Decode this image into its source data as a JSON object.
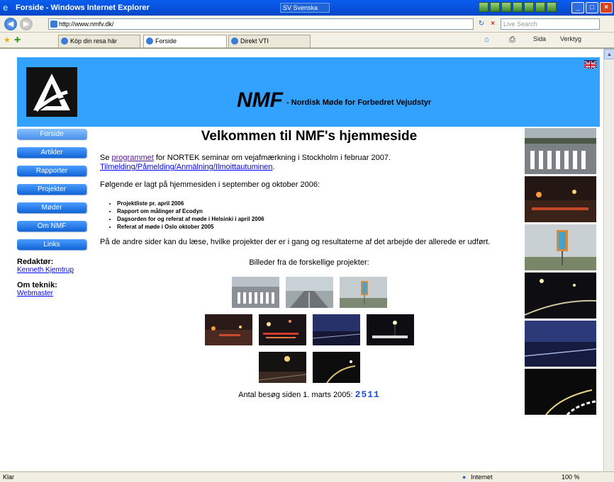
{
  "browser": {
    "title": "Forside - Windows Internet Explorer",
    "language": "SV Svenska",
    "address": "http://www.nmfv.dk/",
    "search_placeholder": "Live Search",
    "tabs": [
      "Köp din resa här",
      "Forside",
      "Direkt VTI"
    ],
    "active_tab": 1,
    "commands": [
      "Sida",
      "Verktyg"
    ],
    "status_left": "Klar",
    "status_zone": "Internet",
    "zoom": "100 %"
  },
  "banner": {
    "brand": "NMF",
    "subtitle": "- Nordisk Møde for Forbedret Vejudstyr",
    "bg_color": "#33a2ff"
  },
  "sidebar": {
    "items": [
      "Forside",
      "Artikler",
      "Rapporter",
      "Projekter",
      "Møder",
      "Om NMF",
      "Links"
    ],
    "active": 0,
    "editor_label": "Redaktør:",
    "editor_name": "Kenneth Kjemtrup",
    "tech_label": "Om teknik:",
    "tech_name": "Webmaster"
  },
  "main": {
    "heading": "Velkommen til NMF's hjemmeside",
    "intro_prefix": "Se ",
    "intro_link": "programmet",
    "intro_suffix": " for NORTEK seminar om vejafmærkning i Stockholm i februar 2007.",
    "signup_link": "Tilmelding/Påmelding/Anmälning/Ilmoittautuminen",
    "signup_suffix": ".",
    "updates_intro": "Følgende er lagt på hjemmesiden i september og oktober 2006:",
    "updates": [
      "Projektliste pr. april 2006",
      "Rapport om målinger af Ecodyn",
      "Dagsorden for og referat af møde i Helsinki i april 2006",
      "Referat af møde i Oslo oktober 2005"
    ],
    "other_pages": "På de andre sider kan du læse, hvilke projekter der er i gang og resultaterne af det arbejde der allerede er udført.",
    "images_caption": "Billeder fra de forskellige projekter:",
    "counter_label": "Antal besøg siden 1. marts 2005:",
    "counter_value": "2511"
  }
}
